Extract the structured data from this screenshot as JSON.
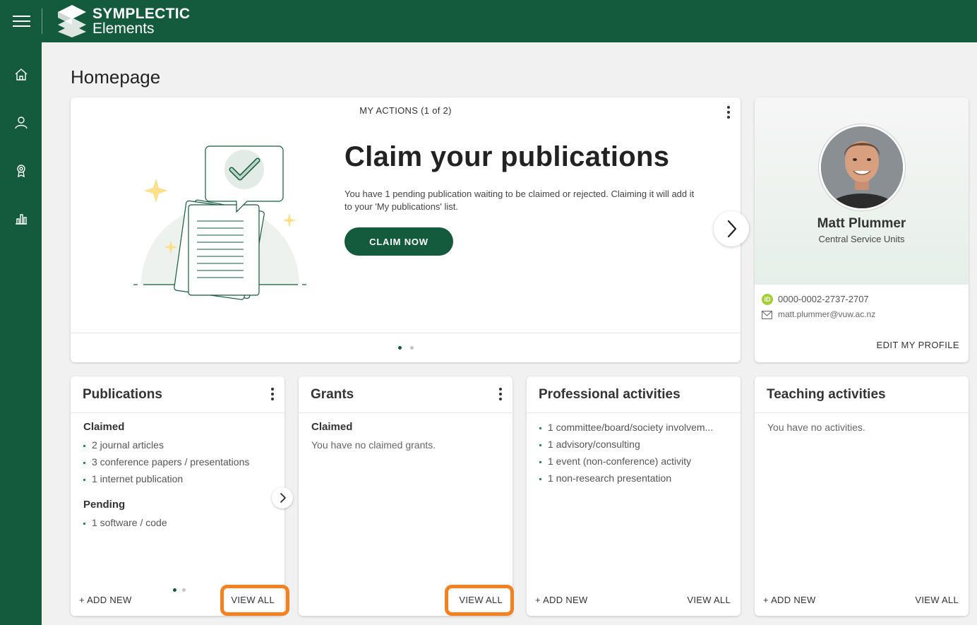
{
  "app": {
    "brand_line1": "SYMPLECTIC",
    "brand_line2": "Elements",
    "primary_color": "#145a3c",
    "accent_color": "#f5801f"
  },
  "nav": {
    "items": [
      {
        "name": "home",
        "icon": "home-icon"
      },
      {
        "name": "profile",
        "icon": "user-icon"
      },
      {
        "name": "achievements",
        "icon": "award-icon"
      },
      {
        "name": "reports",
        "icon": "bar-chart-icon"
      }
    ]
  },
  "page": {
    "title": "Homepage"
  },
  "actions": {
    "header": "MY ACTIONS (1 of 2)",
    "title": "Claim your publications",
    "text": "You have 1 pending publication waiting to be claimed or rejected. Claiming it will add it to your 'My publications' list.",
    "button": "CLAIM NOW",
    "page_current": 1,
    "page_total": 2
  },
  "profile": {
    "name": "Matt Plummer",
    "department": "Central Service Units",
    "orcid": "0000-0002-2737-2707",
    "email": "matt.plummer@vuw.ac.nz",
    "edit": "EDIT MY PROFILE"
  },
  "publications": {
    "title": "Publications",
    "claimed_label": "Claimed",
    "claimed": [
      "2 journal articles",
      "3 conference papers / presentations",
      "1 internet publication"
    ],
    "pending_label": "Pending",
    "pending": [
      "1 software / code"
    ],
    "add": "+ ADD NEW",
    "view": "VIEW ALL"
  },
  "grants": {
    "title": "Grants",
    "claimed_label": "Claimed",
    "empty": "You have no claimed grants.",
    "view": "VIEW ALL"
  },
  "professional": {
    "title": "Professional activities",
    "items": [
      "1 committee/board/society involvem...",
      "1 advisory/consulting",
      "1 event (non-conference) activity",
      "1 non-research presentation"
    ],
    "add": "+ ADD NEW",
    "view": "VIEW ALL"
  },
  "teaching": {
    "title": "Teaching activities",
    "empty": "You have no activities.",
    "add": "+ ADD NEW",
    "view": "VIEW ALL"
  }
}
